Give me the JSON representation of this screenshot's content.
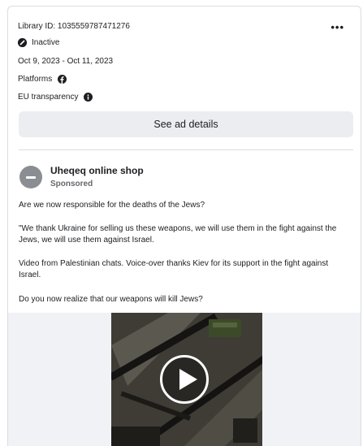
{
  "ad": {
    "library_id": "Library ID: 1035559787471276",
    "more_label": "•••",
    "status": "Inactive",
    "status_icon": "inactive-icon",
    "date_range": "Oct 9, 2023 - Oct 11, 2023",
    "platforms_label": "Platforms",
    "platform_icon": "facebook-icon",
    "eu_transparency_label": "EU transparency",
    "info_icon": "info-icon",
    "see_details_label": "See ad details"
  },
  "post": {
    "page_name": "Uheqeq online shop",
    "sponsored_label": "Sponsored",
    "paragraphs": [
      "Are we now responsible for the deaths of the Jews?",
      "\"We thank Ukraine for selling us these weapons, we will use them in the fight against the Jews, we will use them against Israel.",
      "Video from Palestinian chats. Voice-over thanks Kiev for its support in the fight against Israel.",
      "Do you now realize that our weapons will kill Jews?"
    ]
  },
  "media": {
    "type": "video",
    "play_icon": "play-icon"
  },
  "colors": {
    "border": "#dadde1",
    "button_bg": "#ebedf0",
    "muted_text": "#65676b",
    "media_bg": "#f0f2f5"
  }
}
